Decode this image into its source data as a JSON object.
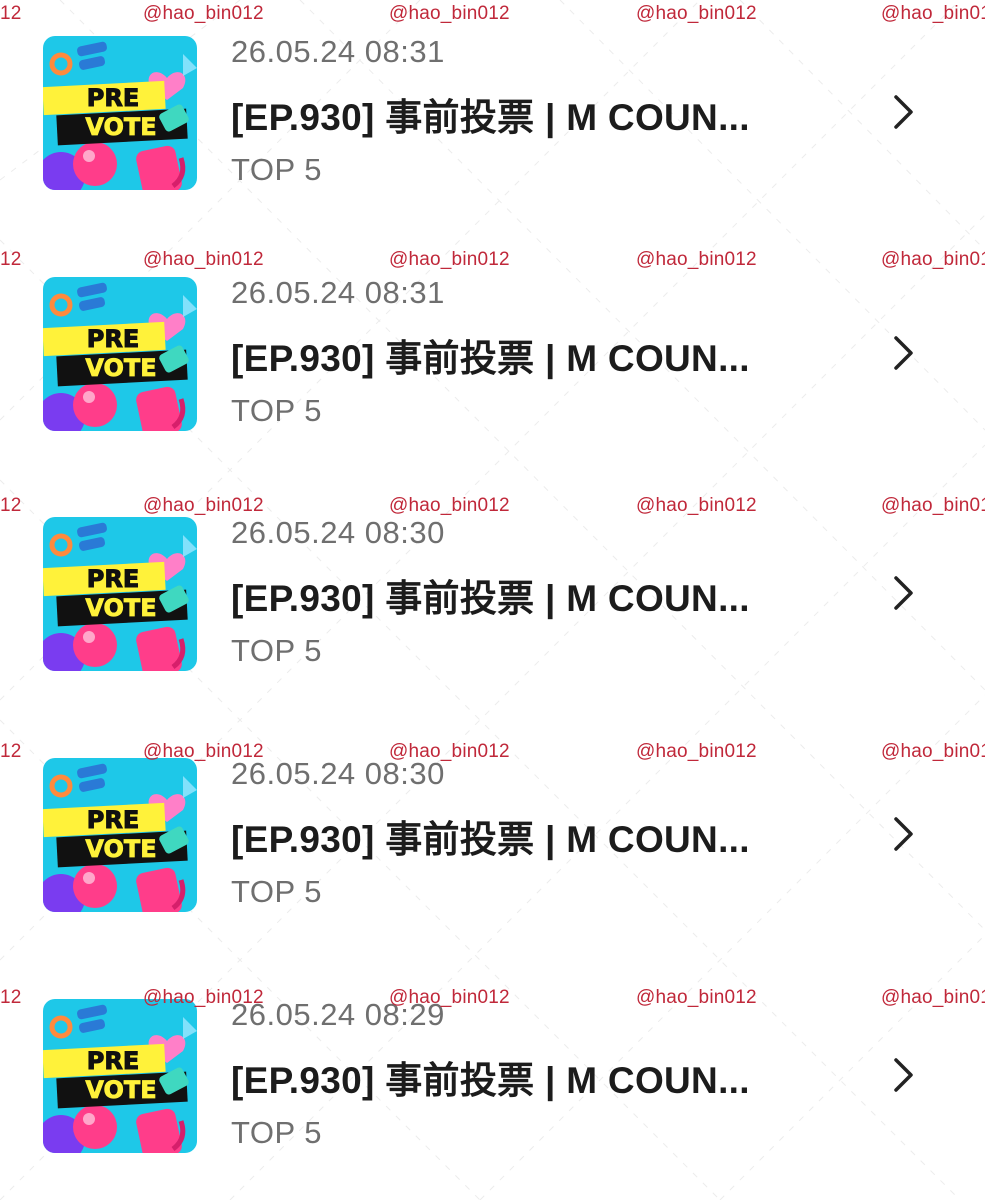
{
  "watermark": {
    "text_full": "@hao_bin012",
    "text_left_edge": "12",
    "text_right_edge": "@hao_bin01"
  },
  "thumbnail": {
    "line1": "PRE",
    "line2": "VOTE",
    "colors": {
      "background": "#1ec8e8",
      "band_yellow": "#fff23a",
      "band_black": "#111111",
      "heart": "#ff7fc8",
      "ball_pink": "#ff3d8a",
      "ball_purple": "#7a3cf0"
    }
  },
  "items": [
    {
      "date": "26.05.24 08:31",
      "title": "[EP.930] 事前投票 | M COUN...",
      "subtitle": "TOP 5",
      "chevron_icon": "chevron-right-icon"
    },
    {
      "date": "26.05.24 08:31",
      "title": "[EP.930] 事前投票 | M COUN...",
      "subtitle": "TOP 5",
      "chevron_icon": "chevron-right-icon"
    },
    {
      "date": "26.05.24 08:30",
      "title": "[EP.930] 事前投票 | M COUN...",
      "subtitle": "TOP 5",
      "chevron_icon": "chevron-right-icon"
    },
    {
      "date": "26.05.24 08:30",
      "title": "[EP.930] 事前投票 | M COUN...",
      "subtitle": "TOP 5",
      "chevron_icon": "chevron-right-icon"
    },
    {
      "date": "26.05.24 08:29",
      "title": "[EP.930] 事前投票 | M COUN...",
      "subtitle": "TOP 5",
      "chevron_icon": "chevron-right-icon"
    }
  ]
}
